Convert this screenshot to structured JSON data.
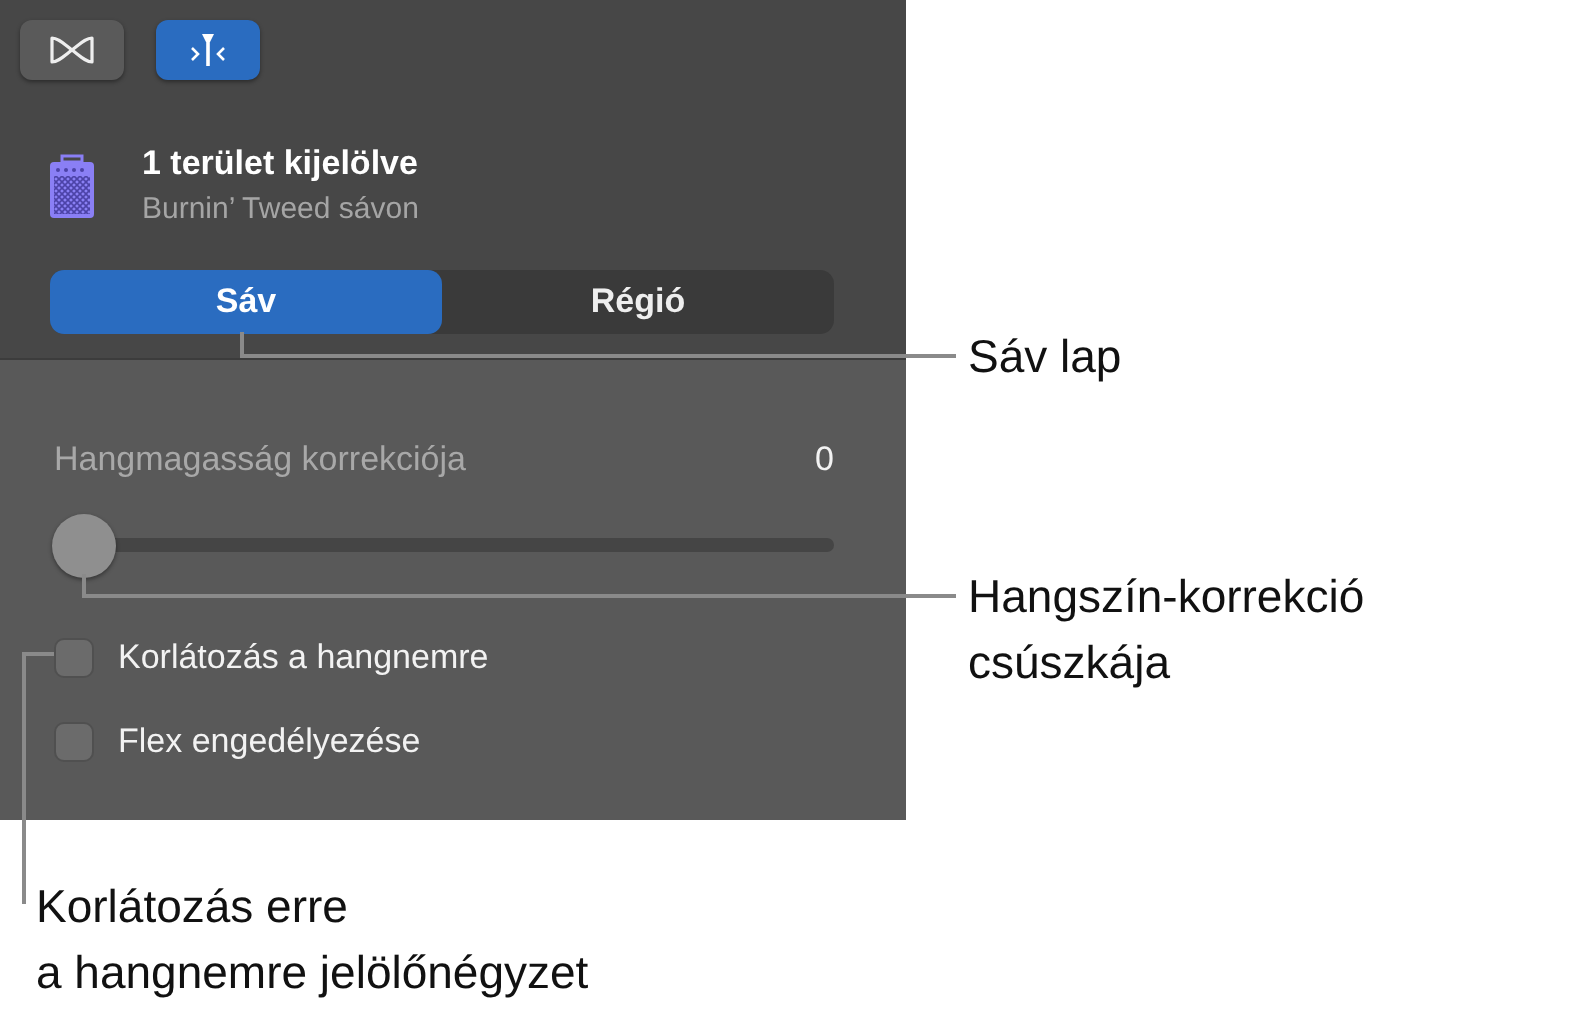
{
  "toolbar": {
    "buttons": [
      {
        "kind": "bowtie",
        "selected": false
      },
      {
        "kind": "tuner",
        "selected": true
      }
    ]
  },
  "header": {
    "title": "1 terület kijelölve",
    "subtitle": "Burnin’ Tweed sávon"
  },
  "tabs": [
    {
      "label": "Sáv",
      "selected": true
    },
    {
      "label": "Régió",
      "selected": false
    }
  ],
  "pitch_correction": {
    "label": "Hangmagasság korrekciója",
    "value": "0",
    "level": 0
  },
  "checkboxes": [
    {
      "label": "Korlátozás a hangnemre",
      "checked": false
    },
    {
      "label": "Flex engedélyezése",
      "checked": false
    }
  ],
  "callouts": [
    {
      "text": "Sáv lap"
    },
    {
      "text": "Hangszín-korrekció\ncsúszkája"
    },
    {
      "text": "Korlátozás erre\na hangnemre jelölőnégyzet"
    }
  ]
}
